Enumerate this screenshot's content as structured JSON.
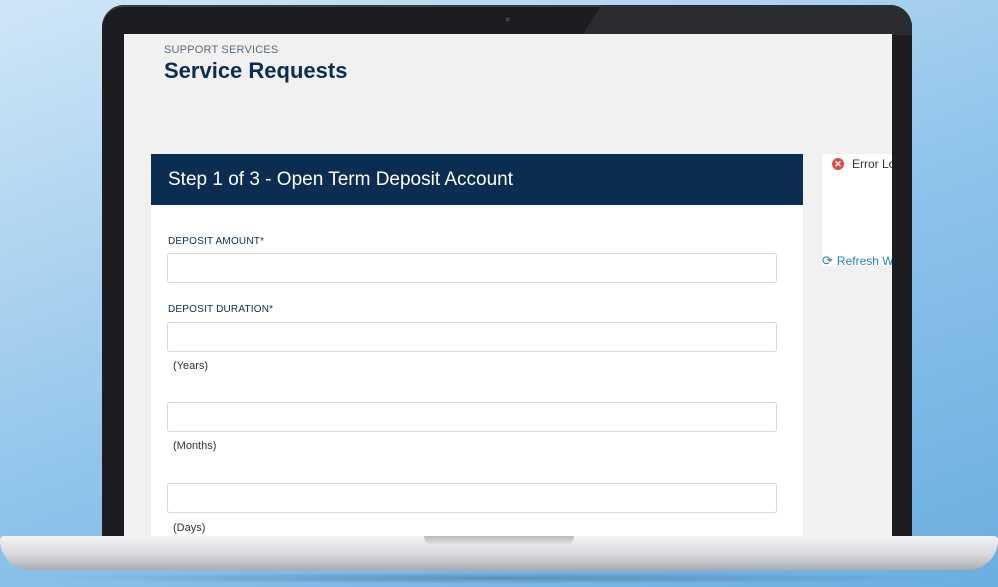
{
  "header": {
    "breadcrumb": "SUPPORT SERVICES",
    "title": "Service Requests"
  },
  "form": {
    "step_title": "Step 1 of 3 - Open Term Deposit Account",
    "deposit_amount_label": "DEPOSIT AMOUNT*",
    "deposit_amount_value": "",
    "deposit_duration_label": "DEPOSIT DURATION*",
    "years_value": "",
    "years_unit": "(Years)",
    "months_value": "",
    "months_unit": "(Months)",
    "days_value": "",
    "days_unit": "(Days)"
  },
  "side_panel": {
    "error_text": "Error Lo",
    "error_icon": "error-circle-icon",
    "refresh_text": "Refresh W",
    "refresh_icon": "refresh-icon"
  },
  "colors": {
    "navy": "#0b2d52",
    "error": "#d84c4c",
    "link": "#2a7fc1"
  }
}
